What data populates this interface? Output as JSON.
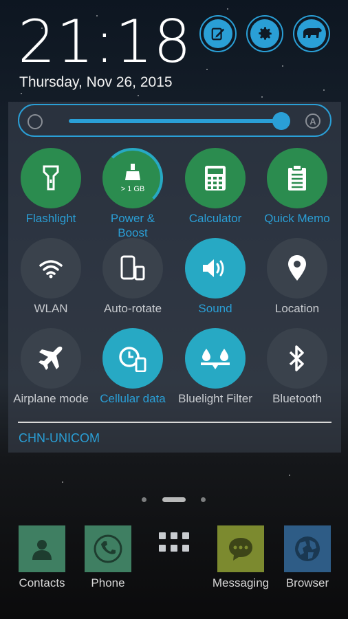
{
  "status": {
    "time": "21:18",
    "date": "Thursday, Nov 26, 2015"
  },
  "header_buttons": [
    {
      "icon": "edit-icon"
    },
    {
      "icon": "gear-icon"
    },
    {
      "icon": "bear-icon"
    }
  ],
  "brightness": {
    "level": 0.93,
    "auto_label": "A"
  },
  "toggles": {
    "flashlight": {
      "label": "Flashlight"
    },
    "power_boost": {
      "label": "Power &\nBoost",
      "memory": "> 1 GB"
    },
    "calculator": {
      "label": "Calculator"
    },
    "quick_memo": {
      "label": "Quick Memo"
    },
    "wlan": {
      "label": "WLAN"
    },
    "auto_rotate": {
      "label": "Auto-rotate"
    },
    "sound": {
      "label": "Sound"
    },
    "location": {
      "label": "Location"
    },
    "airplane": {
      "label": "Airplane mode"
    },
    "cellular": {
      "label": "Cellular data"
    },
    "bluelight": {
      "label": "Bluelight Filter"
    },
    "bluetooth": {
      "label": "Bluetooth"
    }
  },
  "carrier": "CHN-UNICOM",
  "dock": {
    "contacts": "Contacts",
    "phone": "Phone",
    "messaging": "Messaging",
    "browser": "Browser"
  },
  "colors": {
    "accent": "#2a9fd6",
    "active_green": "#2b8c4f",
    "active_teal": "#27a9c4",
    "inactive": "#3a424c"
  }
}
